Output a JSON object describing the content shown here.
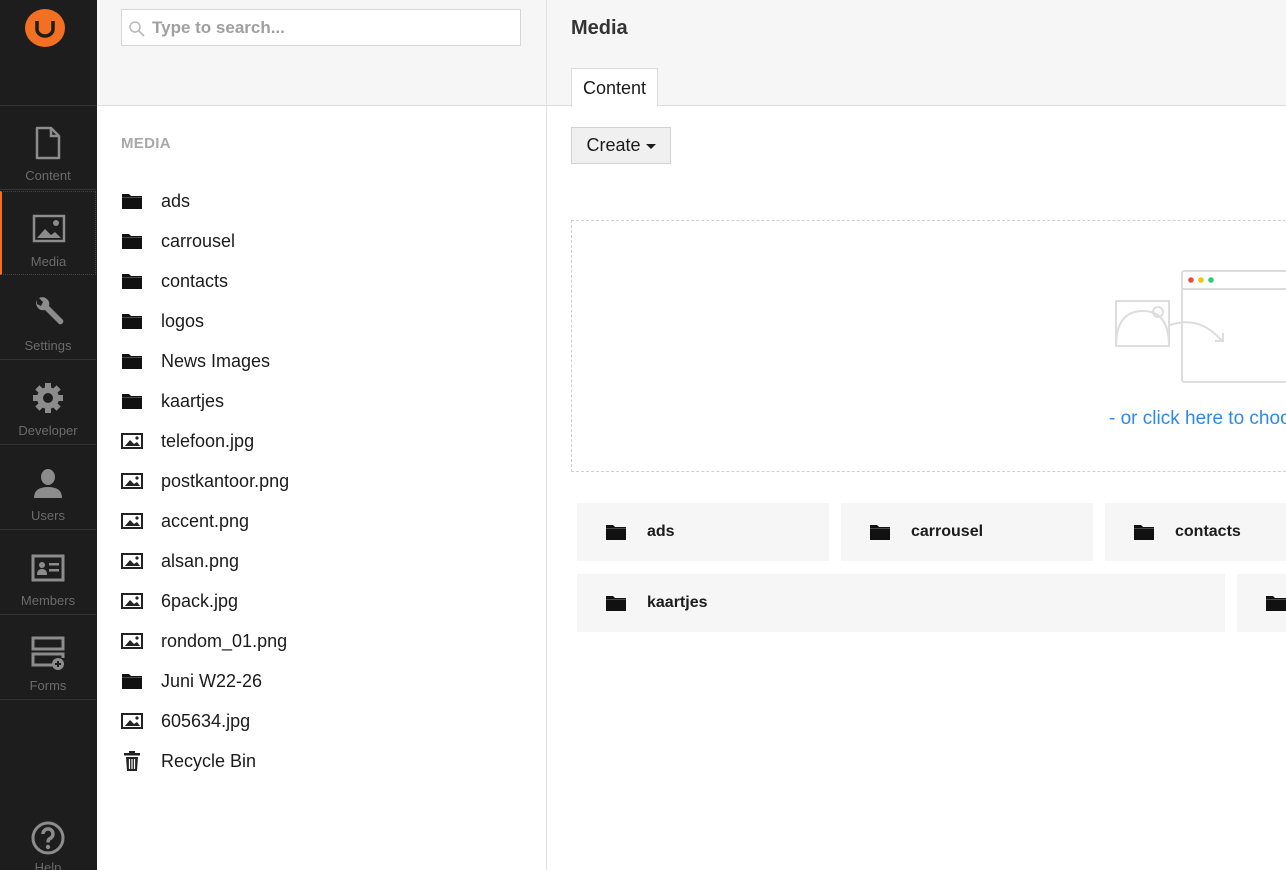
{
  "nav": {
    "logo": "umbraco-logo",
    "items": [
      {
        "label": "Content",
        "icon": "document-icon",
        "active": false
      },
      {
        "label": "Media",
        "icon": "image-icon",
        "active": true
      },
      {
        "label": "Settings",
        "icon": "wrench-icon",
        "active": false
      },
      {
        "label": "Developer",
        "icon": "gear-icon",
        "active": false
      },
      {
        "label": "Users",
        "icon": "user-icon",
        "active": false
      },
      {
        "label": "Members",
        "icon": "id-card-icon",
        "active": false
      },
      {
        "label": "Forms",
        "icon": "form-add-icon",
        "active": false
      }
    ],
    "help": {
      "label": "Help",
      "icon": "help-circle-icon"
    },
    "accent": "#f36f21"
  },
  "tree": {
    "search": {
      "placeholder": "Type to search...",
      "value": ""
    },
    "title": "MEDIA",
    "items": [
      {
        "label": "ads",
        "type": "folder"
      },
      {
        "label": "carrousel",
        "type": "folder"
      },
      {
        "label": "contacts",
        "type": "folder"
      },
      {
        "label": "logos",
        "type": "folder"
      },
      {
        "label": "News Images",
        "type": "folder"
      },
      {
        "label": "kaartjes",
        "type": "folder"
      },
      {
        "label": "telefoon.jpg",
        "type": "image"
      },
      {
        "label": "postkantoor.png",
        "type": "image"
      },
      {
        "label": "accent.png",
        "type": "image"
      },
      {
        "label": "alsan.png",
        "type": "image"
      },
      {
        "label": "6pack.jpg",
        "type": "image"
      },
      {
        "label": "rondom_01.png",
        "type": "image"
      },
      {
        "label": "Juni W22-26",
        "type": "folder"
      },
      {
        "label": "605634.jpg",
        "type": "image"
      },
      {
        "label": "Recycle Bin",
        "type": "trash"
      }
    ]
  },
  "main": {
    "title": "Media",
    "tabs": [
      {
        "label": "Content",
        "active": true
      }
    ],
    "create_label": "Create",
    "dropzone": {
      "link_text": "- or click here to choose files"
    },
    "link_color": "#2e8aea",
    "folders": [
      {
        "label": "ads"
      },
      {
        "label": "carrousel"
      },
      {
        "label": "contacts"
      },
      {
        "label": "kaartjes"
      },
      {
        "label": ""
      }
    ]
  }
}
